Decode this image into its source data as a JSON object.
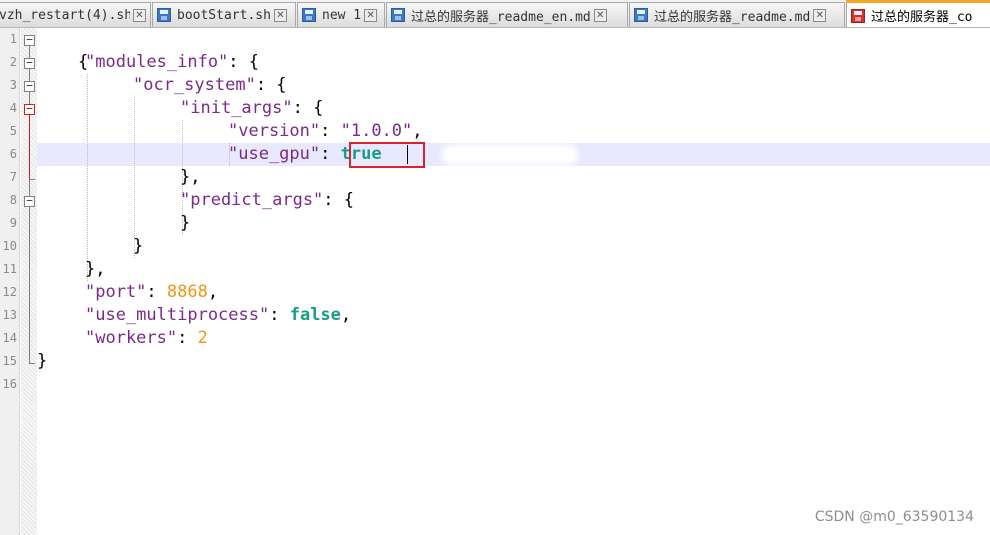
{
  "tabs": [
    {
      "label": "vzh_restart(4).sh",
      "icon": "save-file-icon",
      "active": false
    },
    {
      "label": "bootStart.sh",
      "icon": "save-file-icon",
      "active": false
    },
    {
      "label": "new 1",
      "icon": "save-file-icon",
      "active": false
    },
    {
      "label": "过总的服务器_readme_en.md",
      "icon": "save-file-icon",
      "active": false
    },
    {
      "label": "过总的服务器_readme.md",
      "icon": "save-file-icon",
      "active": false
    },
    {
      "label": "过总的服务器_co",
      "icon": "unsaved-file-icon",
      "active": true
    }
  ],
  "close_glyph": "✕",
  "gutter": {
    "line_numbers": [
      "1",
      "2",
      "3",
      "4",
      "5",
      "6",
      "7",
      "8",
      "9",
      "10",
      "11",
      "12",
      "13",
      "14",
      "15",
      "16"
    ]
  },
  "code": {
    "line1_brace": "{",
    "modules_key": "\"modules_info\"",
    "ocr_key": "\"ocr_system\"",
    "init_args_key": "\"init_args\"",
    "version_key": "\"version\"",
    "version_value": "\"1.0.0\"",
    "use_gpu_key": "\"use_gpu\"",
    "use_gpu_value": "true",
    "init_close": "},",
    "predict_key": "\"predict_args\"",
    "predict_close": "}",
    "ocr_close": "}",
    "modules_close": "},",
    "port_key": "\"port\"",
    "port_value": "8868",
    "multiprocess_key": "\"use_multiprocess\"",
    "multiprocess_value": "false",
    "workers_key": "\"workers\"",
    "workers_value": "2",
    "final_brace": "}"
  },
  "watermark": "CSDN @m0_63590134",
  "colors": {
    "string": "#7a2a8a",
    "number": "#f29512",
    "keyword": "#1a9a8a",
    "active_tab_accent": "#f5a623",
    "highlight_box": "#d8232a",
    "current_line": "#e8e8ff"
  }
}
